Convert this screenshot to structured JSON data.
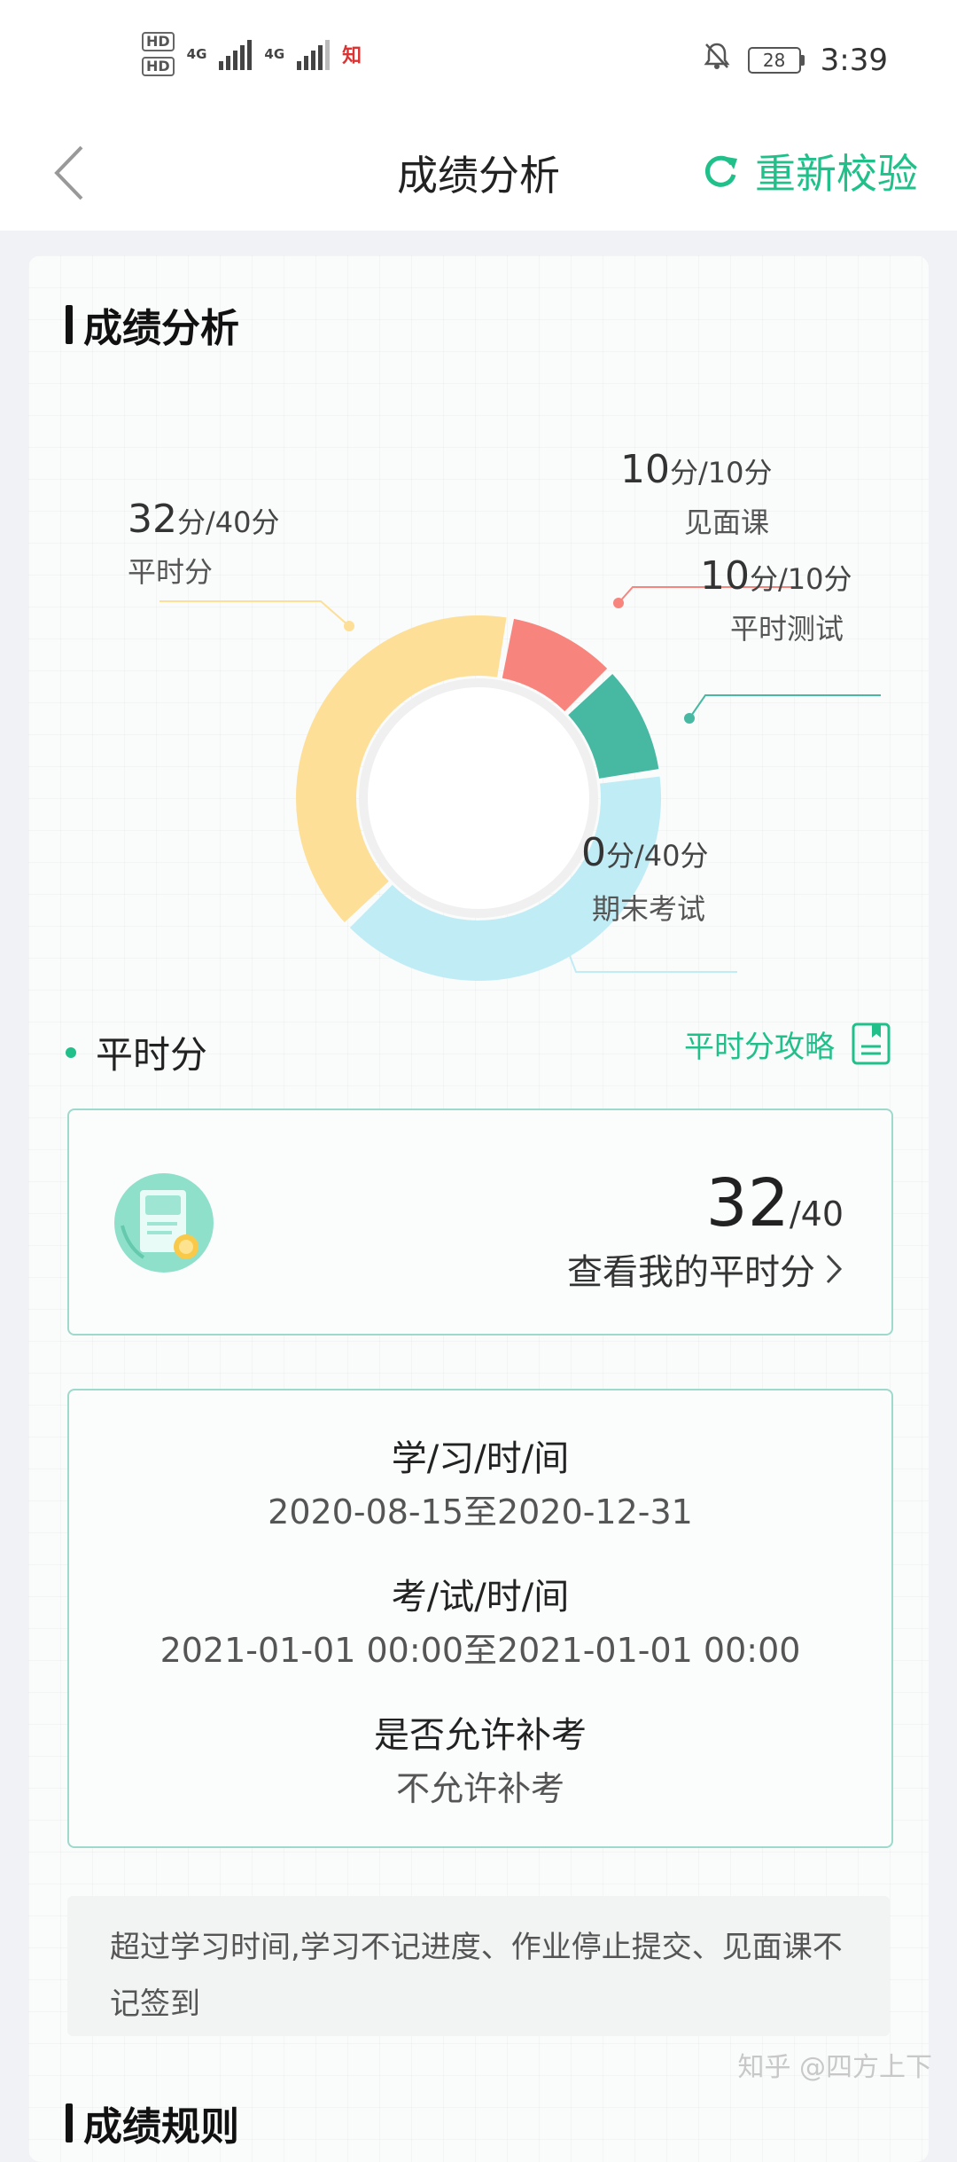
{
  "status_bar": {
    "hd1": "HD",
    "hd2": "HD",
    "net1": "4G",
    "net2": "4G",
    "battery": "28",
    "time": "3:39"
  },
  "nav": {
    "title": "成绩分析",
    "revalidate_label": "重新校验"
  },
  "analysis": {
    "section_title": "成绩分析"
  },
  "chart_data": {
    "type": "pie",
    "slices": [
      {
        "name": "平时分",
        "score": "32",
        "score_unit": "分/40分",
        "value": 32,
        "max": 40,
        "color": "#fddf98"
      },
      {
        "name": "见面课",
        "score": "10",
        "score_unit": "分/10分",
        "value": 10,
        "max": 10,
        "color": "#f8857d"
      },
      {
        "name": "平时测试",
        "score": "10",
        "score_unit": "分/10分",
        "value": 10,
        "max": 10,
        "color": "#47b8a2"
      },
      {
        "name": "期末考试",
        "score": "0",
        "score_unit": "分/40分",
        "value": 0,
        "max": 40,
        "color": "#c0ecf5"
      }
    ]
  },
  "regular": {
    "heading": "平时分",
    "strategy_label": "平时分攻略",
    "score": "32",
    "score_total": "/40",
    "view_label": "查看我的平时分"
  },
  "info": {
    "study_time_label": "学/习/时/间",
    "study_time_value": "2020-08-15至2020-12-31",
    "exam_time_label": "考/试/时/间",
    "exam_time_value": "2021-01-01 00:00至2021-01-01 00:00",
    "makeup_label": "是否允许补考",
    "makeup_value": "不允许补考"
  },
  "note": {
    "text": "超过学习时间,学习不记进度、作业停止提交、见面课不记签到"
  },
  "rules": {
    "section_title": "成绩规则"
  },
  "watermark": "知乎 @四方上下",
  "colors": {
    "accent": "#21c08b",
    "border": "#9fd9cc"
  }
}
